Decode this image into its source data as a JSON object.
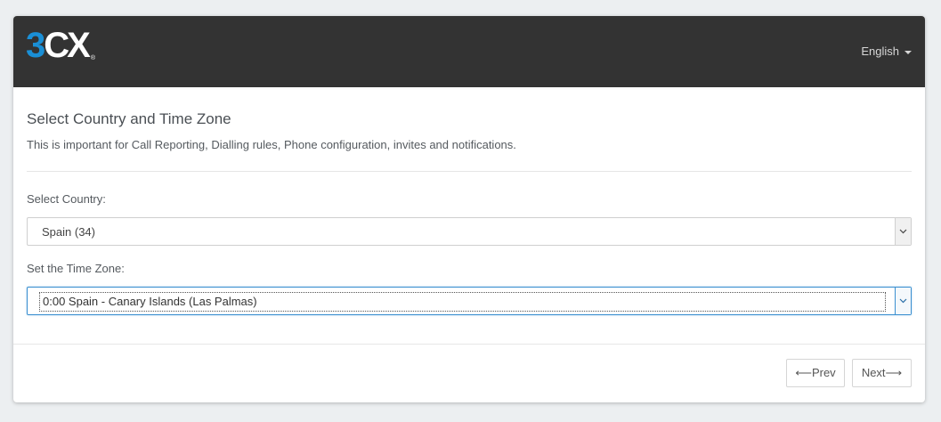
{
  "header": {
    "logo_three": "3",
    "logo_cx": "CX",
    "logo_reg": "®",
    "language_label": "English"
  },
  "section": {
    "title": "Select Country and Time Zone",
    "description": "This is important for Call Reporting, Dialling rules, Phone configuration, invites and notifications."
  },
  "country": {
    "label": "Select Country:",
    "selected": "Spain (34)"
  },
  "timezone": {
    "label": "Set the Time Zone:",
    "selected": "0:00 Spain - Canary Islands (Las Palmas)"
  },
  "footer": {
    "prev_label": "⟵Prev",
    "next_label": "Next⟶"
  },
  "colors": {
    "header_bg": "#333333",
    "brand_blue": "#1a8fd6",
    "focus_blue": "#3a8fd0"
  }
}
